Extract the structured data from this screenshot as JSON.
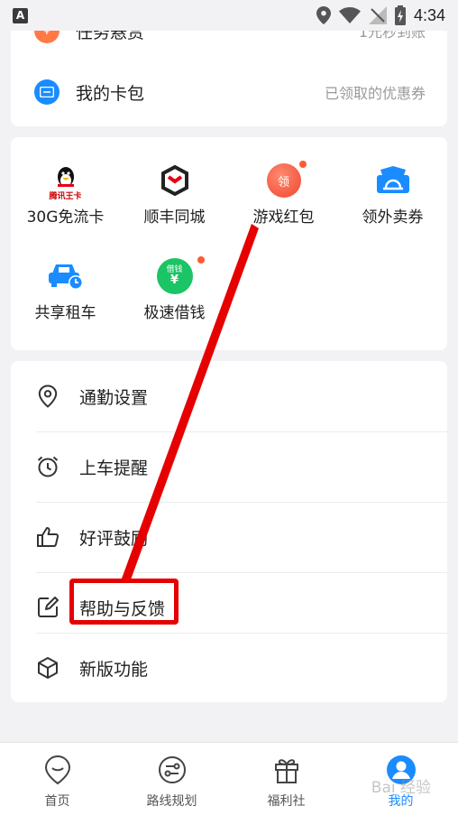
{
  "status_bar": {
    "time": "4:34",
    "notification_glyph": "A"
  },
  "top_card": {
    "partial_row": {
      "label": "任务悬赏",
      "right_text": "1元秒到账"
    },
    "wallet_row": {
      "label": "我的卡包",
      "right_text": "已领取的优惠券"
    }
  },
  "services": {
    "items": [
      {
        "label": "30G免流卡",
        "icon": "qq-penguin-icon",
        "badge_text": "腾讯王卡"
      },
      {
        "label": "顺丰同城",
        "icon": "sf-box-icon"
      },
      {
        "label": "游戏红包",
        "icon": "red-packet-icon",
        "badge_text": "领",
        "has_dot": true
      },
      {
        "label": "领外卖券",
        "icon": "ticket-icon"
      },
      {
        "label": "共享租车",
        "icon": "car-clock-icon"
      },
      {
        "label": "极速借钱",
        "icon": "loan-money-icon",
        "badge_text": "借钱",
        "has_dot": true
      }
    ]
  },
  "settings_list": {
    "items": [
      {
        "label": "通勤设置",
        "icon": "location-pin-icon"
      },
      {
        "label": "上车提醒",
        "icon": "alarm-clock-icon"
      },
      {
        "label": "好评鼓励",
        "icon": "thumbs-up-icon"
      },
      {
        "label": "帮助与反馈",
        "icon": "edit-note-icon",
        "highlighted": true
      },
      {
        "label": "新版功能",
        "icon": "cube-icon"
      }
    ]
  },
  "tab_bar": {
    "tabs": [
      {
        "label": "首页",
        "icon": "home-pin-icon",
        "active": false
      },
      {
        "label": "路线规划",
        "icon": "route-icon",
        "active": false
      },
      {
        "label": "福利社",
        "icon": "gift-icon",
        "active": false
      },
      {
        "label": "我的",
        "icon": "profile-icon",
        "active": true
      }
    ]
  },
  "colors": {
    "accent_blue": "#1a8cff",
    "highlight_red": "#e60000",
    "badge_dot": "#ff5a36"
  },
  "watermark": "Bai 经验"
}
